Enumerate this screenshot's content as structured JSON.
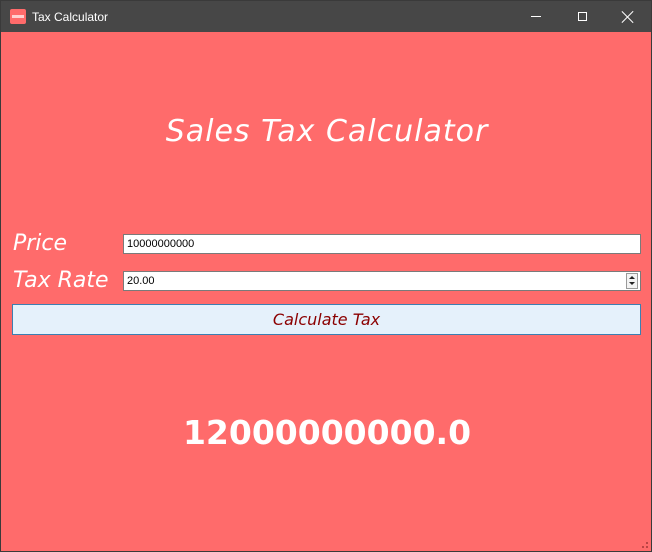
{
  "window": {
    "title": "Tax Calculator"
  },
  "main": {
    "heading": "Sales Tax Calculator",
    "price": {
      "label": "Price",
      "value": "10000000000"
    },
    "tax_rate": {
      "label": "Tax Rate",
      "value": "20.00"
    },
    "calculate_label": "Calculate Tax",
    "result": "12000000000.0"
  },
  "colors": {
    "background": "#ff6b6b",
    "titlebar": "#474747",
    "button_bg": "#e5f1fb",
    "button_text": "#8b0000"
  }
}
